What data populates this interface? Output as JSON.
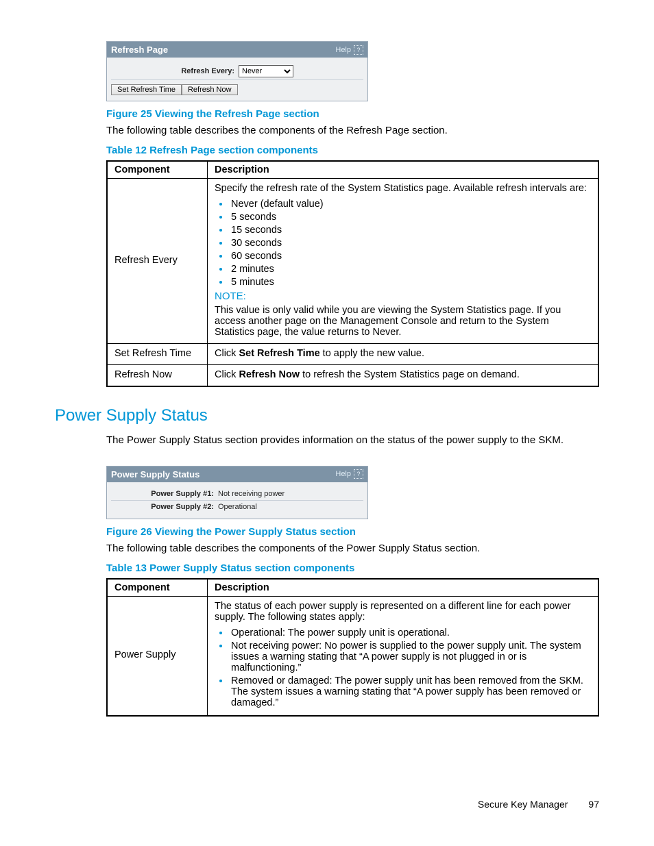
{
  "refresh_panel": {
    "title": "Refresh Page",
    "help": "Help",
    "label": "Refresh Every:",
    "select_value": "Never",
    "btn_set_time": "Set Refresh Time",
    "btn_refresh_now": "Refresh Now"
  },
  "fig25": "Figure 25 Viewing the Refresh Page section",
  "fig25_text": "The following table describes the components of the Refresh Page section.",
  "table12_caption": "Table 12 Refresh Page section components",
  "table12": {
    "h_component": "Component",
    "h_description": "Description",
    "r1_c1": "Refresh Every",
    "r1_intro": "Specify the refresh rate of the System Statistics page. Available refresh intervals are:",
    "r1_items": [
      "Never (default value)",
      "5 seconds",
      "15 seconds",
      "30 seconds",
      "60 seconds",
      "2 minutes",
      "5 minutes"
    ],
    "r1_note_label": "NOTE:",
    "r1_note_text": "This value is only valid while you are viewing the System Statistics page. If you access another page on the Management Console and return to the System Statistics page, the value returns to Never.",
    "r2_c1": "Set Refresh Time",
    "r2_pre": "Click ",
    "r2_bold": "Set Refresh Time",
    "r2_post": " to apply the new value.",
    "r3_c1": "Refresh Now",
    "r3_pre": "Click ",
    "r3_bold": "Refresh Now",
    "r3_post": " to refresh the System Statistics page on demand."
  },
  "pss_heading": "Power Supply Status",
  "pss_intro": "The Power Supply Status section provides information on the status of the power supply to the SKM.",
  "pss_panel": {
    "title": "Power Supply Status",
    "help": "Help",
    "row1_label": "Power Supply #1:",
    "row1_value": "Not receiving power",
    "row2_label": "Power Supply #2:",
    "row2_value": "Operational"
  },
  "fig26": "Figure 26 Viewing the Power Supply Status section",
  "fig26_text": "The following table describes the components of the Power Supply Status section.",
  "table13_caption": "Table 13 Power Supply Status section components",
  "table13": {
    "h_component": "Component",
    "h_description": "Description",
    "r1_c1": "Power Supply",
    "r1_intro": "The status of each power supply is represented on a different line for each power supply. The following states apply:",
    "r1_items": [
      "Operational: The power supply unit is operational.",
      "Not receiving power: No power is supplied to the power supply unit. The system issues a warning stating that “A power supply is not plugged in or is malfunctioning.”",
      "Removed or damaged: The power supply unit has been removed from the SKM. The system issues a warning stating that “A power supply has been removed or damaged.”"
    ]
  },
  "footer_product": "Secure Key Manager",
  "footer_page": "97"
}
